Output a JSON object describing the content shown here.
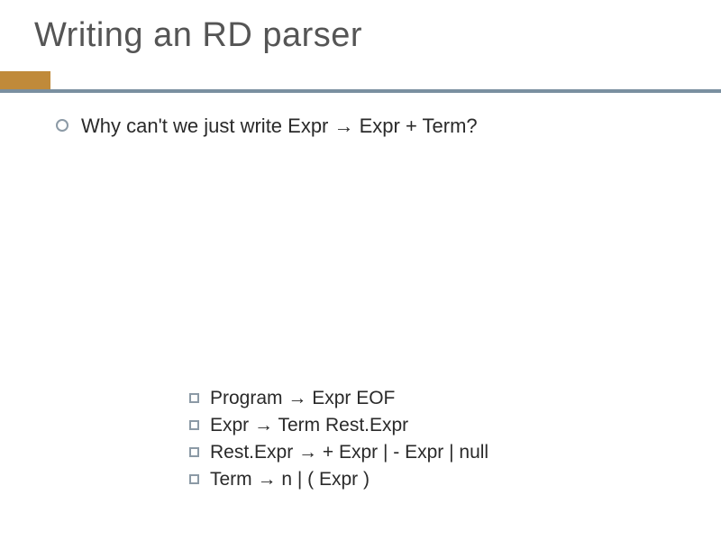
{
  "title": "Writing an RD parser",
  "main_bullet": "Why can't we just write  Expr → Expr + Term?",
  "grammar": {
    "items": [
      "Program → Expr EOF",
      "Expr → Term Rest.Expr",
      "Rest.Expr → + Expr | - Expr | null",
      "Term → n | ( Expr )"
    ]
  }
}
